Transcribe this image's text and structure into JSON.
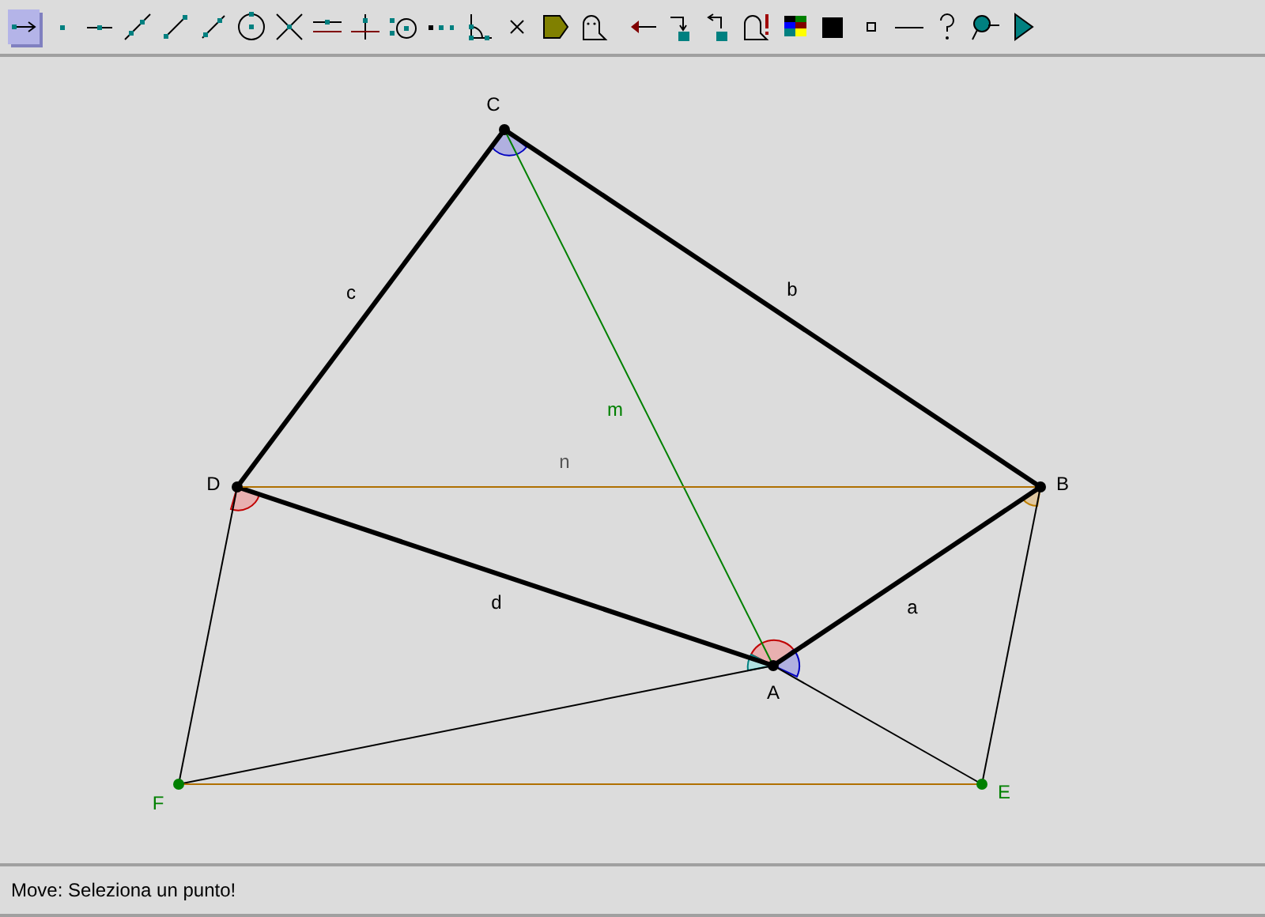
{
  "toolbar": {
    "tools": [
      {
        "kind": "move",
        "selected": true
      },
      {
        "kind": "point",
        "selected": false
      },
      {
        "kind": "pointonline",
        "selected": false
      },
      {
        "kind": "line",
        "selected": false
      },
      {
        "kind": "segment",
        "selected": false
      },
      {
        "kind": "ray",
        "selected": false
      },
      {
        "kind": "circle",
        "selected": false
      },
      {
        "kind": "intersection",
        "selected": false
      },
      {
        "kind": "parallel",
        "selected": false
      },
      {
        "kind": "perpendicular",
        "selected": false
      },
      {
        "kind": "center",
        "selected": false
      },
      {
        "kind": "dots",
        "selected": false
      },
      {
        "kind": "angle",
        "selected": false
      },
      {
        "kind": "cross",
        "selected": false
      },
      {
        "kind": "polygon",
        "selected": false
      },
      {
        "kind": "ghost",
        "selected": false
      },
      {
        "kind": "back",
        "selected": false
      },
      {
        "kind": "trashdown",
        "selected": false
      },
      {
        "kind": "trashup",
        "selected": false
      },
      {
        "kind": "ghostalert",
        "selected": false
      },
      {
        "kind": "palette",
        "selected": false
      },
      {
        "kind": "filled",
        "selected": false
      },
      {
        "kind": "small",
        "selected": false
      },
      {
        "kind": "stroke",
        "selected": false
      },
      {
        "kind": "help",
        "selected": false
      },
      {
        "kind": "pin",
        "selected": false
      },
      {
        "kind": "play",
        "selected": false
      }
    ]
  },
  "canvas": {
    "points": [
      {
        "label": "A",
        "color": "#000000"
      },
      {
        "label": "B",
        "color": "#000000"
      },
      {
        "label": "C",
        "color": "#000000"
      },
      {
        "label": "D",
        "color": "#000000"
      },
      {
        "label": "E",
        "color": "#008000"
      },
      {
        "label": "F",
        "color": "#008000"
      }
    ],
    "segments": [
      {
        "label": "a",
        "kind": "side"
      },
      {
        "label": "b",
        "kind": "side"
      },
      {
        "label": "c",
        "kind": "side"
      },
      {
        "label": "d",
        "kind": "side"
      },
      {
        "label": "m",
        "kind": "median"
      },
      {
        "label": "n",
        "kind": "diagonal"
      }
    ]
  },
  "status_bar": {
    "message": "Move: Seleziona un punto!"
  }
}
